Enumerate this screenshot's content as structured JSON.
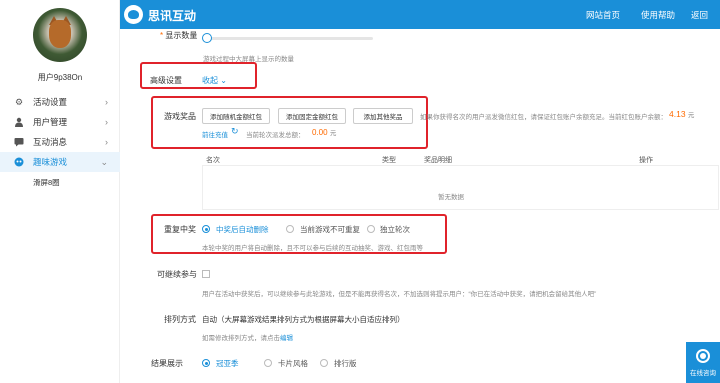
{
  "header": {
    "brand": "思讯互动",
    "nav": [
      "网站首页",
      "使用帮助",
      "返回"
    ],
    "accent": "#1a8fd8"
  },
  "sidebar": {
    "username": "用户9p38On",
    "items": [
      {
        "label": "活动设置",
        "icon": "gear-icon"
      },
      {
        "label": "用户管理",
        "icon": "user-icon"
      },
      {
        "label": "互动消息",
        "icon": "message-icon"
      },
      {
        "label": "趣味游戏",
        "icon": "game-icon"
      }
    ],
    "sub_item": "滑屏8圈"
  },
  "display_count": {
    "label": "显示数量",
    "hint": "游戏过程中大屏幕上显示的数量"
  },
  "advanced": {
    "label": "高级设置",
    "toggle": "收起",
    "chevron": "chevron-down-icon"
  },
  "prizes": {
    "label": "游戏奖品",
    "buttons": [
      "添加随机金额红包",
      "添加固定金额红包",
      "添加其他奖品"
    ],
    "note": "如果你获得名次的用户派发微信红包，请保证红包账户余额充足。当前红包账户余额：",
    "balance": "4.13",
    "unit": "元",
    "recharge": "前往充值",
    "round_label": "当前轮次派发总额：",
    "round_amount": "0.00",
    "round_unit": "元"
  },
  "table": {
    "columns": [
      "名次",
      "类型",
      "奖品明细",
      "操作"
    ],
    "empty": "暂无数据"
  },
  "repeat": {
    "label": "重复中奖",
    "options": [
      "中奖后自动删除",
      "当前游戏不可重复",
      "独立轮次"
    ],
    "selected": 0,
    "hint": "本轮中奖的用户将自动删除，且不可以参与后续的互动抽奖、游戏、红包雨等"
  },
  "continue_join": {
    "label": "可继续参与",
    "hint": "用户在活动中获奖后，可以继续参与此轮游戏，但是不能再获得名次，不加选则将提示用户：“你已在活动中获奖，请把机会留给其他人吧”"
  },
  "sort": {
    "label": "排列方式",
    "value": "自动（大屏幕游戏结果排列方式为根据屏幕大小自适应排列）",
    "hint": "如需修改排列方式，请点击",
    "link": "编辑"
  },
  "result": {
    "label": "结果展示",
    "options": [
      "冠亚季",
      "卡片风格",
      "排行版"
    ],
    "selected": 0
  },
  "chat": {
    "label": "在线咨询",
    "icon": "headset-icon"
  }
}
